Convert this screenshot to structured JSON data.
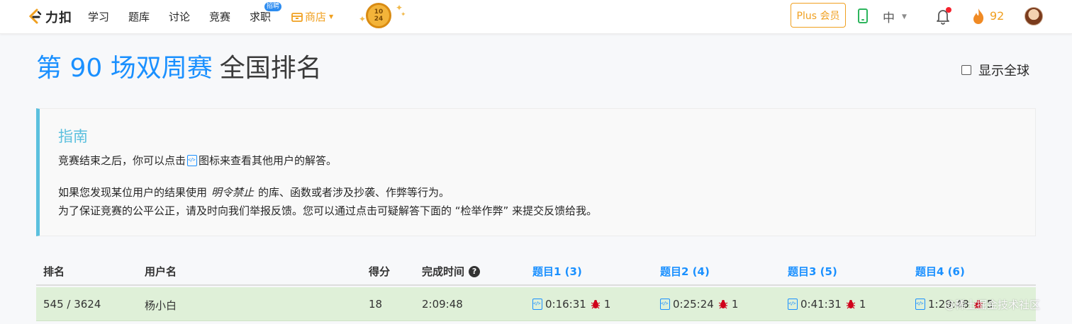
{
  "nav": {
    "logo_text": "力扣",
    "items": [
      "学习",
      "题库",
      "讨论",
      "竞赛",
      "求职"
    ],
    "jobs_badge": "招聘",
    "shop_label": "商店",
    "coin_lines": [
      "10",
      "24"
    ],
    "plus_label": "Plus 会员",
    "lang_label": "中",
    "points": "92"
  },
  "page": {
    "title_blue": "第 90 场双周赛",
    "title_dark": "全国排名",
    "global_toggle_label": "显示全球"
  },
  "guide": {
    "title": "指南",
    "line1_before": "竞赛结束之后，你可以点击",
    "line1_after": "图标来查看其他用户的解答。",
    "line2_before": "如果您发现某位用户的结果使用",
    "line2_em": "明令禁止",
    "line2_after": "的库、函数或者涉及抄袭、作弊等行为。",
    "line3": "为了保证竞赛的公平公正，请及时向我们举报反馈。您可以通过点击可疑解答下面的 “检举作弊” 来提交反馈给我。"
  },
  "table": {
    "headers": {
      "rank": "排名",
      "username": "用户名",
      "score": "得分",
      "finish_time": "完成时间",
      "q1": "题目1 (3)",
      "q2": "题目2 (4)",
      "q3": "题目3 (5)",
      "q4": "题目4 (6)"
    },
    "row": {
      "rank": "545 / 3624",
      "username": "杨小白",
      "score": "18",
      "finish_time": "2:09:48",
      "q1": {
        "time": "0:16:31",
        "bugs": "1"
      },
      "q2": {
        "time": "0:25:24",
        "bugs": "1"
      },
      "q3": {
        "time": "0:41:31",
        "bugs": "1"
      },
      "q4": {
        "time": "1:29:48",
        "bugs": "5"
      }
    }
  },
  "watermark": "@稀土掘金技术社区",
  "colors": {
    "accent_blue": "#1a90ff",
    "shop_orange": "#f0a020",
    "guide_cyan": "#5bc0de",
    "row_green": "#dff0d8",
    "bug_red": "#d0021b"
  },
  "icons": [
    "logo-icon",
    "shop-icon",
    "coin-icon",
    "phone-icon",
    "bell-icon",
    "fire-icon",
    "avatar",
    "solution-icon",
    "bug-icon",
    "help-icon"
  ]
}
